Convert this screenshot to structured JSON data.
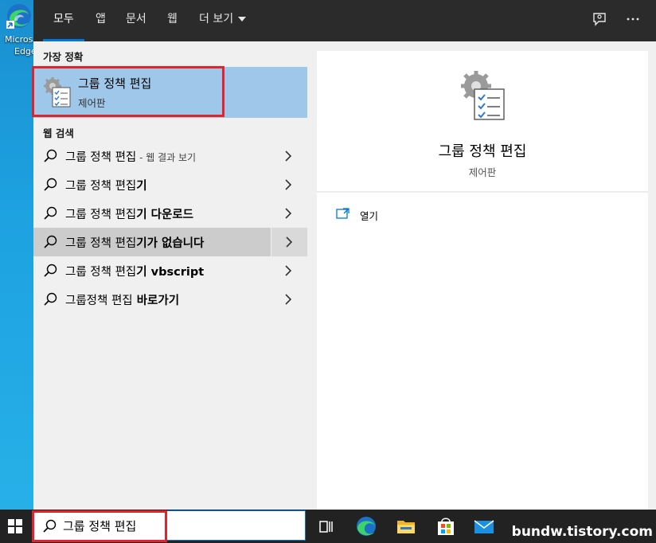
{
  "desktop": {
    "edge_icon_label_line1": "Micros",
    "edge_icon_label_line2": "Edge"
  },
  "topbar": {
    "tabs": [
      {
        "label": "모두",
        "active": true
      },
      {
        "label": "앱"
      },
      {
        "label": "문서"
      },
      {
        "label": "웹"
      },
      {
        "label": "더 보기"
      }
    ],
    "feedback_icon": "feedback-icon",
    "more_icon": "ellipsis-icon"
  },
  "best_match": {
    "header": "가장 정확",
    "title": "그룹 정책 편집",
    "subtitle": "제어판",
    "icon": "group-policy-icon"
  },
  "web_search": {
    "header": "웹 검색",
    "results": [
      {
        "prefix": "그룹 정책 편집",
        "suffix": "",
        "meta": " - 웹 결과 보기"
      },
      {
        "prefix": "그룹 정책 편집",
        "suffix": "기",
        "meta": ""
      },
      {
        "prefix": "그룹 정책 편집",
        "suffix": "기 다운로드",
        "meta": ""
      },
      {
        "prefix": "그룹 정책 편집",
        "suffix": "기가 없습니다",
        "meta": "",
        "highlighted": true
      },
      {
        "prefix": "그룹 정책 편집",
        "suffix": "기 vbscript",
        "meta": ""
      },
      {
        "prefix": "그룹정책 편집",
        "suffix": " 바로가기",
        "meta": ""
      }
    ]
  },
  "preview": {
    "title": "그룹 정책 편집",
    "subtitle": "제어판",
    "actions": [
      {
        "label": "열기",
        "icon": "open-icon"
      }
    ]
  },
  "taskbar": {
    "search_value": "그룹 정책 편집",
    "apps": [
      "task-view-icon",
      "edge-icon",
      "file-explorer-icon",
      "store-icon",
      "mail-icon"
    ]
  },
  "watermark": "bundw.tistory.com",
  "colors": {
    "accent": "#0078d7",
    "highlight": "#9fc7ea",
    "outline": "#e0242e"
  }
}
